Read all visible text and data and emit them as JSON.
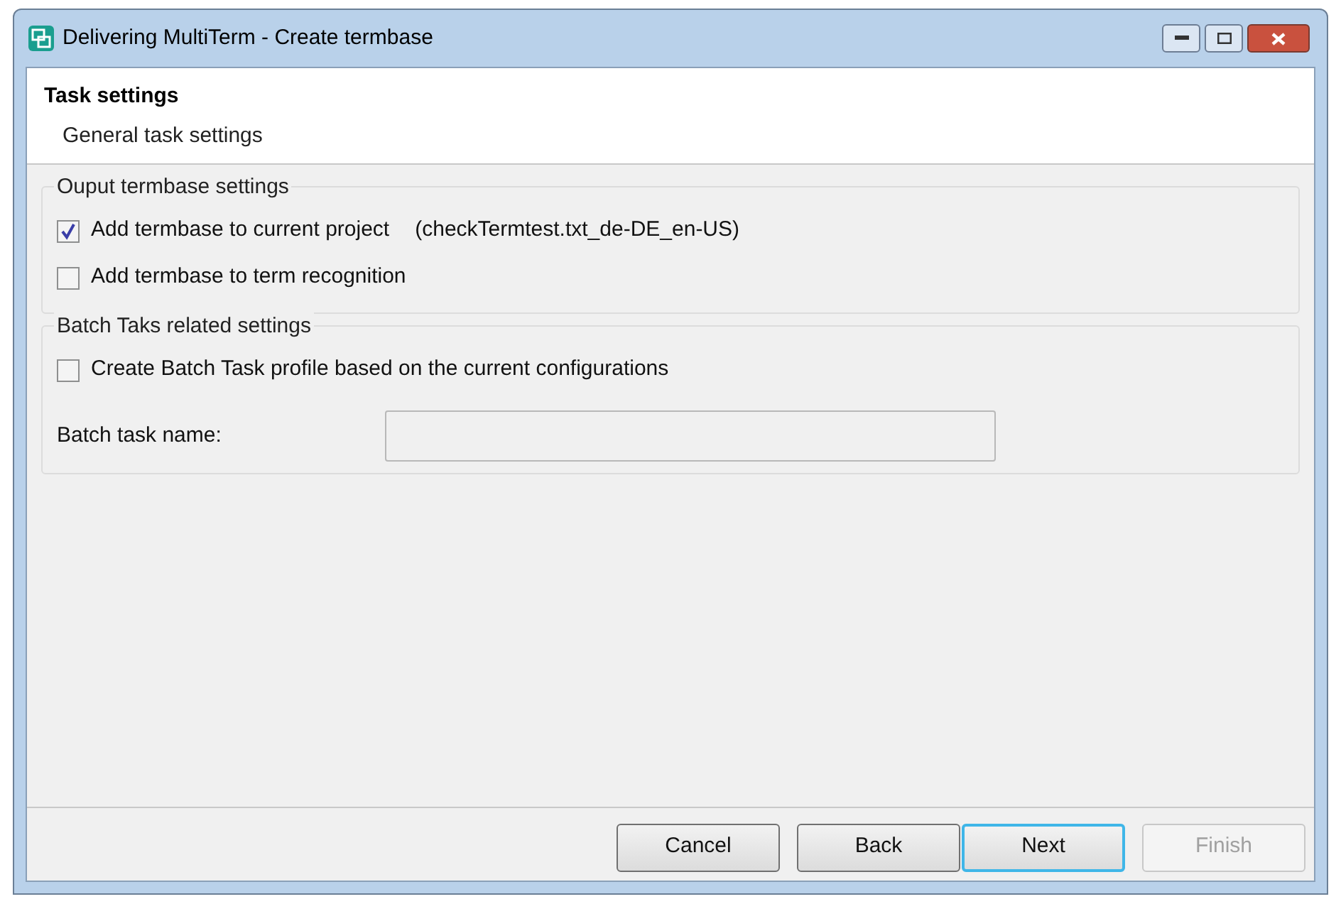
{
  "window": {
    "title": "Delivering MultiTerm - Create termbase"
  },
  "header": {
    "title": "Task settings",
    "subtitle": "General task settings"
  },
  "groups": [
    {
      "title": "Ouput termbase settings",
      "options": [
        {
          "label": "Add termbase to current project",
          "note": "(checkTermtest.txt_de-DE_en-US)",
          "checked": true
        },
        {
          "label": "Add termbase to term recognition",
          "checked": false
        }
      ]
    },
    {
      "title": "Batch Taks related settings",
      "options": [
        {
          "label": "Create Batch Task profile based on the current configurations",
          "checked": false
        }
      ],
      "field": {
        "label": "Batch task name:",
        "disabled": true
      }
    }
  ],
  "buttons": [
    {
      "label": "Cancel",
      "focused": false,
      "disabled": false
    },
    {
      "label": "Back",
      "focused": false,
      "disabled": false
    },
    {
      "label": "Next",
      "focused": true,
      "disabled": false
    },
    {
      "label": "Finish",
      "focused": false,
      "disabled": true
    }
  ]
}
